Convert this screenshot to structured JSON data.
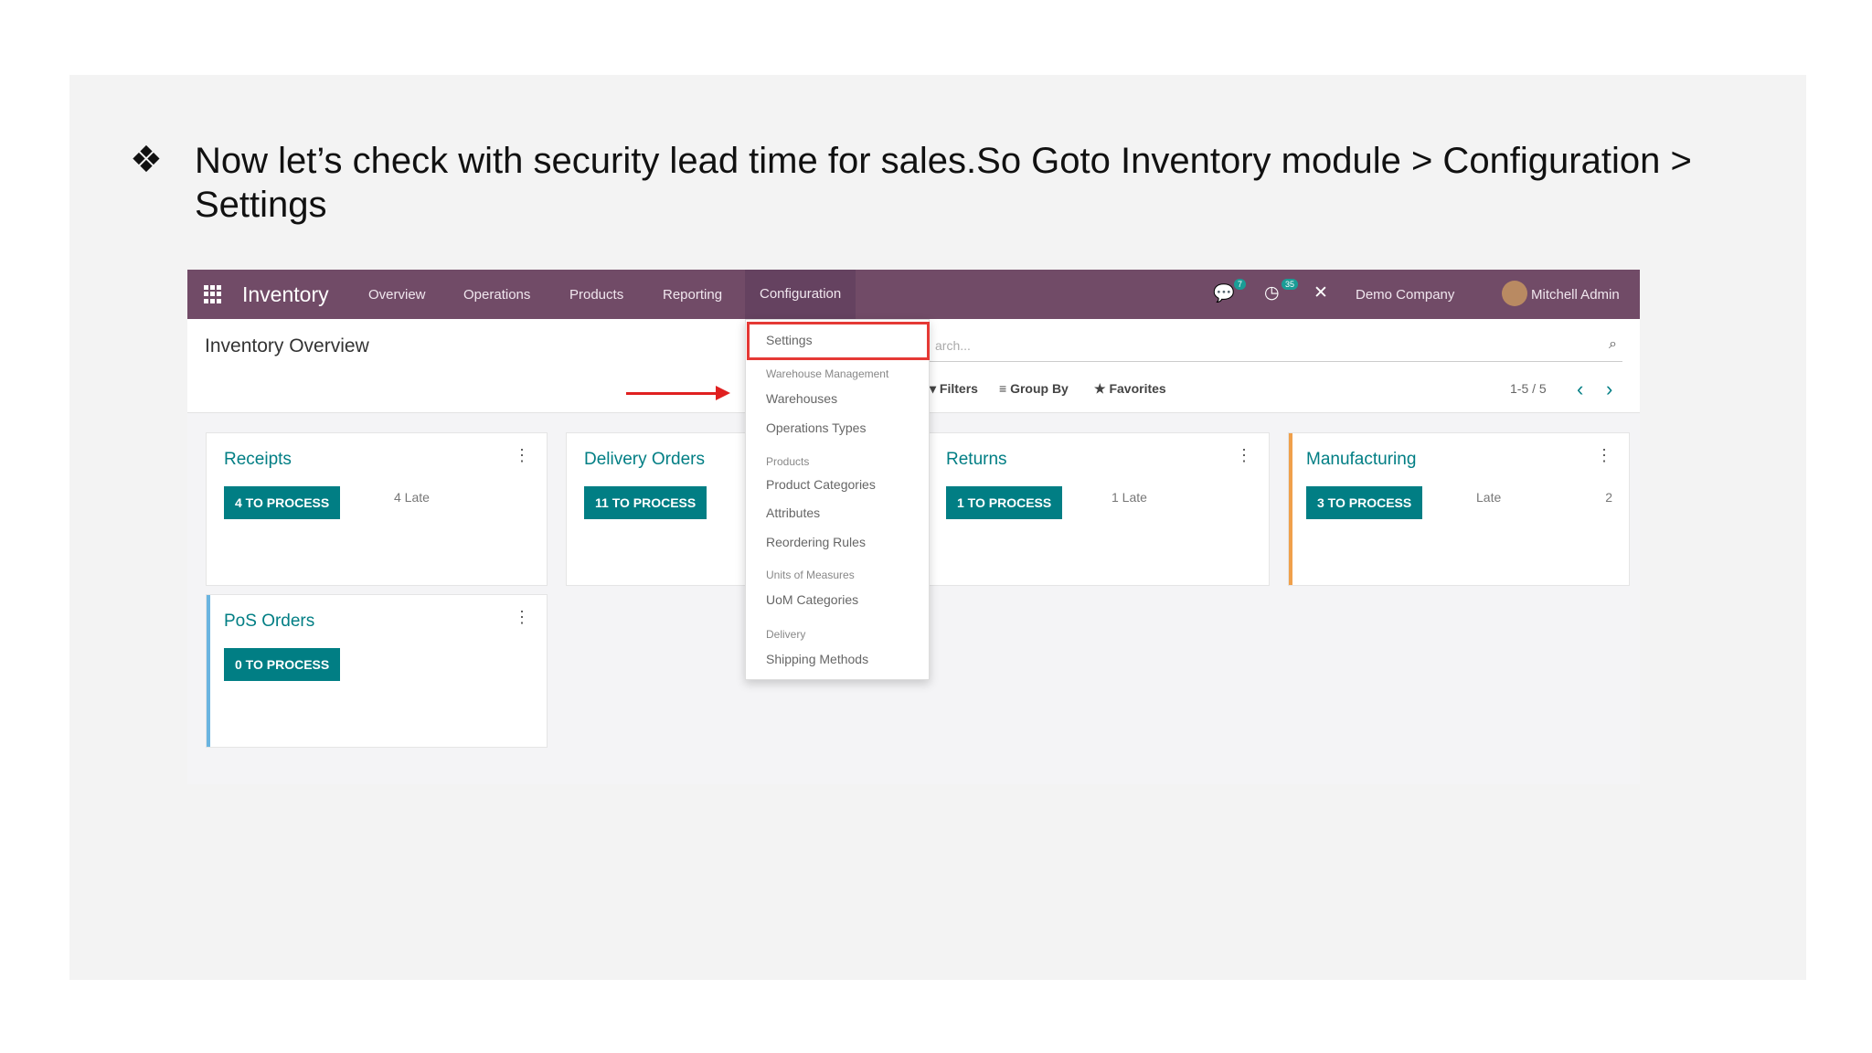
{
  "slide": {
    "bullet_symbol": "❖",
    "text": "Now let’s check with security lead time for sales.So Goto Inventory module > Configuration > Settings"
  },
  "app": {
    "brand": "Inventory",
    "menu": [
      "Overview",
      "Operations",
      "Products",
      "Reporting",
      "Configuration"
    ],
    "active_menu": "Configuration",
    "messages_badge": "7",
    "activities_badge": "35",
    "company": "Demo Company",
    "user": "Mitchell Admin"
  },
  "control_panel": {
    "title": "Inventory Overview",
    "search_placeholder": "arch...",
    "filters_label": "Filters",
    "group_by_label": "Group By",
    "favorites_label": "Favorites",
    "pager": "1-5 / 5"
  },
  "dropdown": {
    "items": [
      {
        "kind": "item",
        "label": "Settings"
      },
      {
        "kind": "header",
        "label": "Warehouse Management"
      },
      {
        "kind": "item",
        "label": "Warehouses"
      },
      {
        "kind": "item",
        "label": "Operations Types"
      },
      {
        "kind": "header",
        "label": "Products"
      },
      {
        "kind": "item",
        "label": "Product Categories"
      },
      {
        "kind": "item",
        "label": "Attributes"
      },
      {
        "kind": "item",
        "label": "Reordering Rules"
      },
      {
        "kind": "header",
        "label": "Units of Measures"
      },
      {
        "kind": "item",
        "label": "UoM Categories"
      },
      {
        "kind": "header",
        "label": "Delivery"
      },
      {
        "kind": "item",
        "label": "Shipping Methods"
      }
    ]
  },
  "cards": [
    {
      "name": "Receipts",
      "button": "4 TO PROCESS",
      "late": "4 Late",
      "count": "",
      "stripe": "#ffffff"
    },
    {
      "name": "Delivery Orders",
      "button": "11 TO PROCESS",
      "late": "",
      "count": "",
      "stripe": "#ffffff"
    },
    {
      "name": "Returns",
      "button": "1 TO PROCESS",
      "late": "1 Late",
      "count": "",
      "stripe": "#ffffff"
    },
    {
      "name": "Manufacturing",
      "button": "3 TO PROCESS",
      "late": "Late",
      "count": "2",
      "stripe": "#f0a04b"
    },
    {
      "name": "PoS Orders",
      "button": "0 TO PROCESS",
      "late": "",
      "count": "",
      "stripe": "#6ab4e0"
    }
  ],
  "colors": {
    "topbar": "#714b67",
    "accent": "#017e84",
    "highlight": "#e53935"
  }
}
